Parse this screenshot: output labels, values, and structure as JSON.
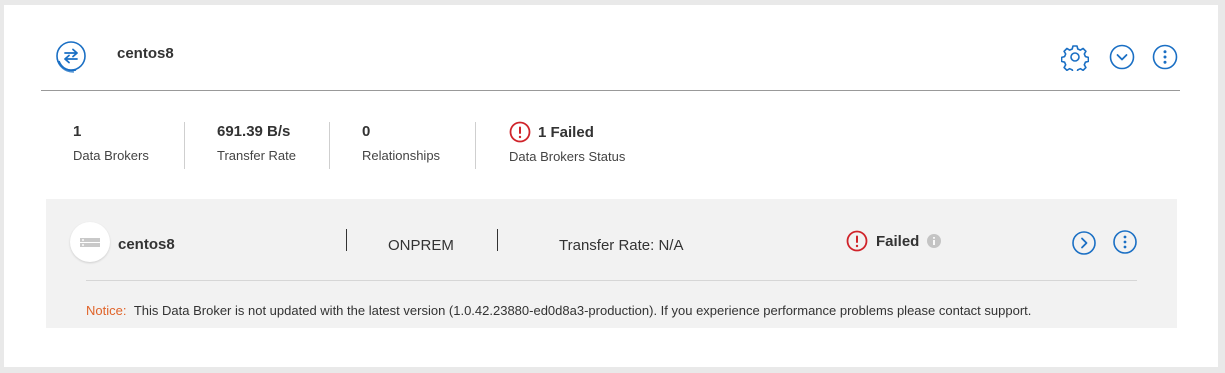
{
  "group": {
    "title": "centos8",
    "icon": "sync-arrows-icon"
  },
  "header_actions": [
    {
      "name": "settings-gear-icon"
    },
    {
      "name": "expand-chevron-icon"
    },
    {
      "name": "more-options-icon"
    }
  ],
  "stats": {
    "data_brokers": {
      "value": "1",
      "label": "Data Brokers"
    },
    "transfer_rate": {
      "value": "691.39 B/s",
      "label": "Transfer Rate"
    },
    "relationships": {
      "value": "0",
      "label": "Relationships"
    },
    "status": {
      "value": "1 Failed",
      "label": "Data Brokers Status"
    }
  },
  "broker": {
    "name": "centos8",
    "type": "ONPREM",
    "transfer_rate": "Transfer Rate: N/A",
    "status": "Failed",
    "notice_label": "Notice:",
    "notice_text": "This Data Broker is not updated with the latest version (1.0.42.23880-ed0d8a3-production). If you experience performance problems please contact support."
  },
  "colors": {
    "accent": "#1a6fc4",
    "error": "#d0232a",
    "notice": "#e0642a"
  }
}
